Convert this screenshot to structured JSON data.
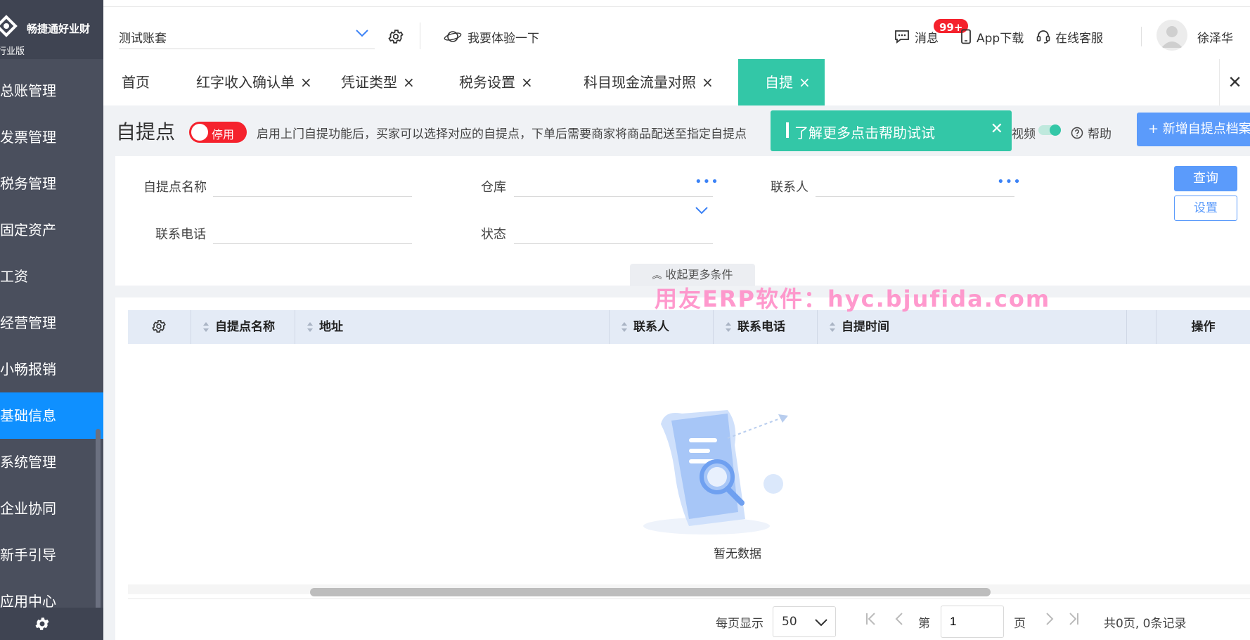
{
  "app": {
    "brand_name": "畅捷通好业财",
    "brand_sub": "行业版"
  },
  "sidebar": {
    "items": [
      {
        "label": "总账管理",
        "active": false
      },
      {
        "label": "发票管理",
        "active": false
      },
      {
        "label": "税务管理",
        "active": false
      },
      {
        "label": "固定资产",
        "active": false
      },
      {
        "label": "工资",
        "active": false
      },
      {
        "label": "经营管理",
        "active": false
      },
      {
        "label": "小畅报销",
        "active": false
      },
      {
        "label": "基础信息",
        "active": true
      },
      {
        "label": "系统管理",
        "active": false
      },
      {
        "label": "企业协同",
        "active": false
      },
      {
        "label": "新手引导",
        "active": false
      },
      {
        "label": "应用中心",
        "active": false
      }
    ],
    "footer_icon": "gear-icon"
  },
  "header": {
    "account": "测试账套",
    "try_label": "我要体验一下",
    "messages_label": "消息",
    "messages_badge": "99+",
    "app_download_label": "App下载",
    "service_label": "在线客服",
    "username": "徐泽华"
  },
  "tabs": [
    {
      "label": "首页",
      "closable": false,
      "active": false
    },
    {
      "label": "红字收入确认单",
      "closable": true,
      "active": false
    },
    {
      "label": "凭证类型",
      "closable": true,
      "active": false
    },
    {
      "label": "税务设置",
      "closable": true,
      "active": false
    },
    {
      "label": "科目现金流量对照",
      "closable": true,
      "active": false
    },
    {
      "label": "自提",
      "closable": true,
      "active": true
    }
  ],
  "tab_close_glyph": "×",
  "page": {
    "title": "自提点",
    "toggle_label": "停用",
    "description": "启用上门自提功能后，买家可以选择对应的自提点，下单后需要商家将商品配送至指定自提点",
    "toast_text": "了解更多点击帮助试试",
    "video_label": "视频",
    "help_label": "帮助",
    "add_button": "+ 新增自提点档案"
  },
  "filters": {
    "name_label": "自提点名称",
    "warehouse_label": "仓库",
    "contact_label": "联系人",
    "phone_label": "联系电话",
    "status_label": "状态",
    "query_button": "查询",
    "settings_button": "设置",
    "collapse_label": "收起更多条件",
    "name_value": "",
    "warehouse_value": "",
    "contact_value": "",
    "phone_value": "",
    "status_value": ""
  },
  "watermark": "用友ERP软件：hyc.bjufida.com",
  "table": {
    "columns": [
      "自提点名称",
      "地址",
      "联系人",
      "联系电话",
      "自提时间"
    ],
    "operation_header": "操作",
    "rows": [],
    "empty_text": "暂无数据"
  },
  "pagination": {
    "per_page_label": "每页显示",
    "per_page": "50",
    "page_prefix": "第",
    "page_value": "1",
    "page_suffix": "页",
    "summary": "共0页, 0条记录"
  },
  "colors": {
    "sidebar_bg": "#4a4f5d",
    "active_menu": "#0f90ff",
    "accent_teal": "#33c7a7",
    "primary_blue": "#5b9bfb",
    "danger_red": "#f5222d"
  }
}
